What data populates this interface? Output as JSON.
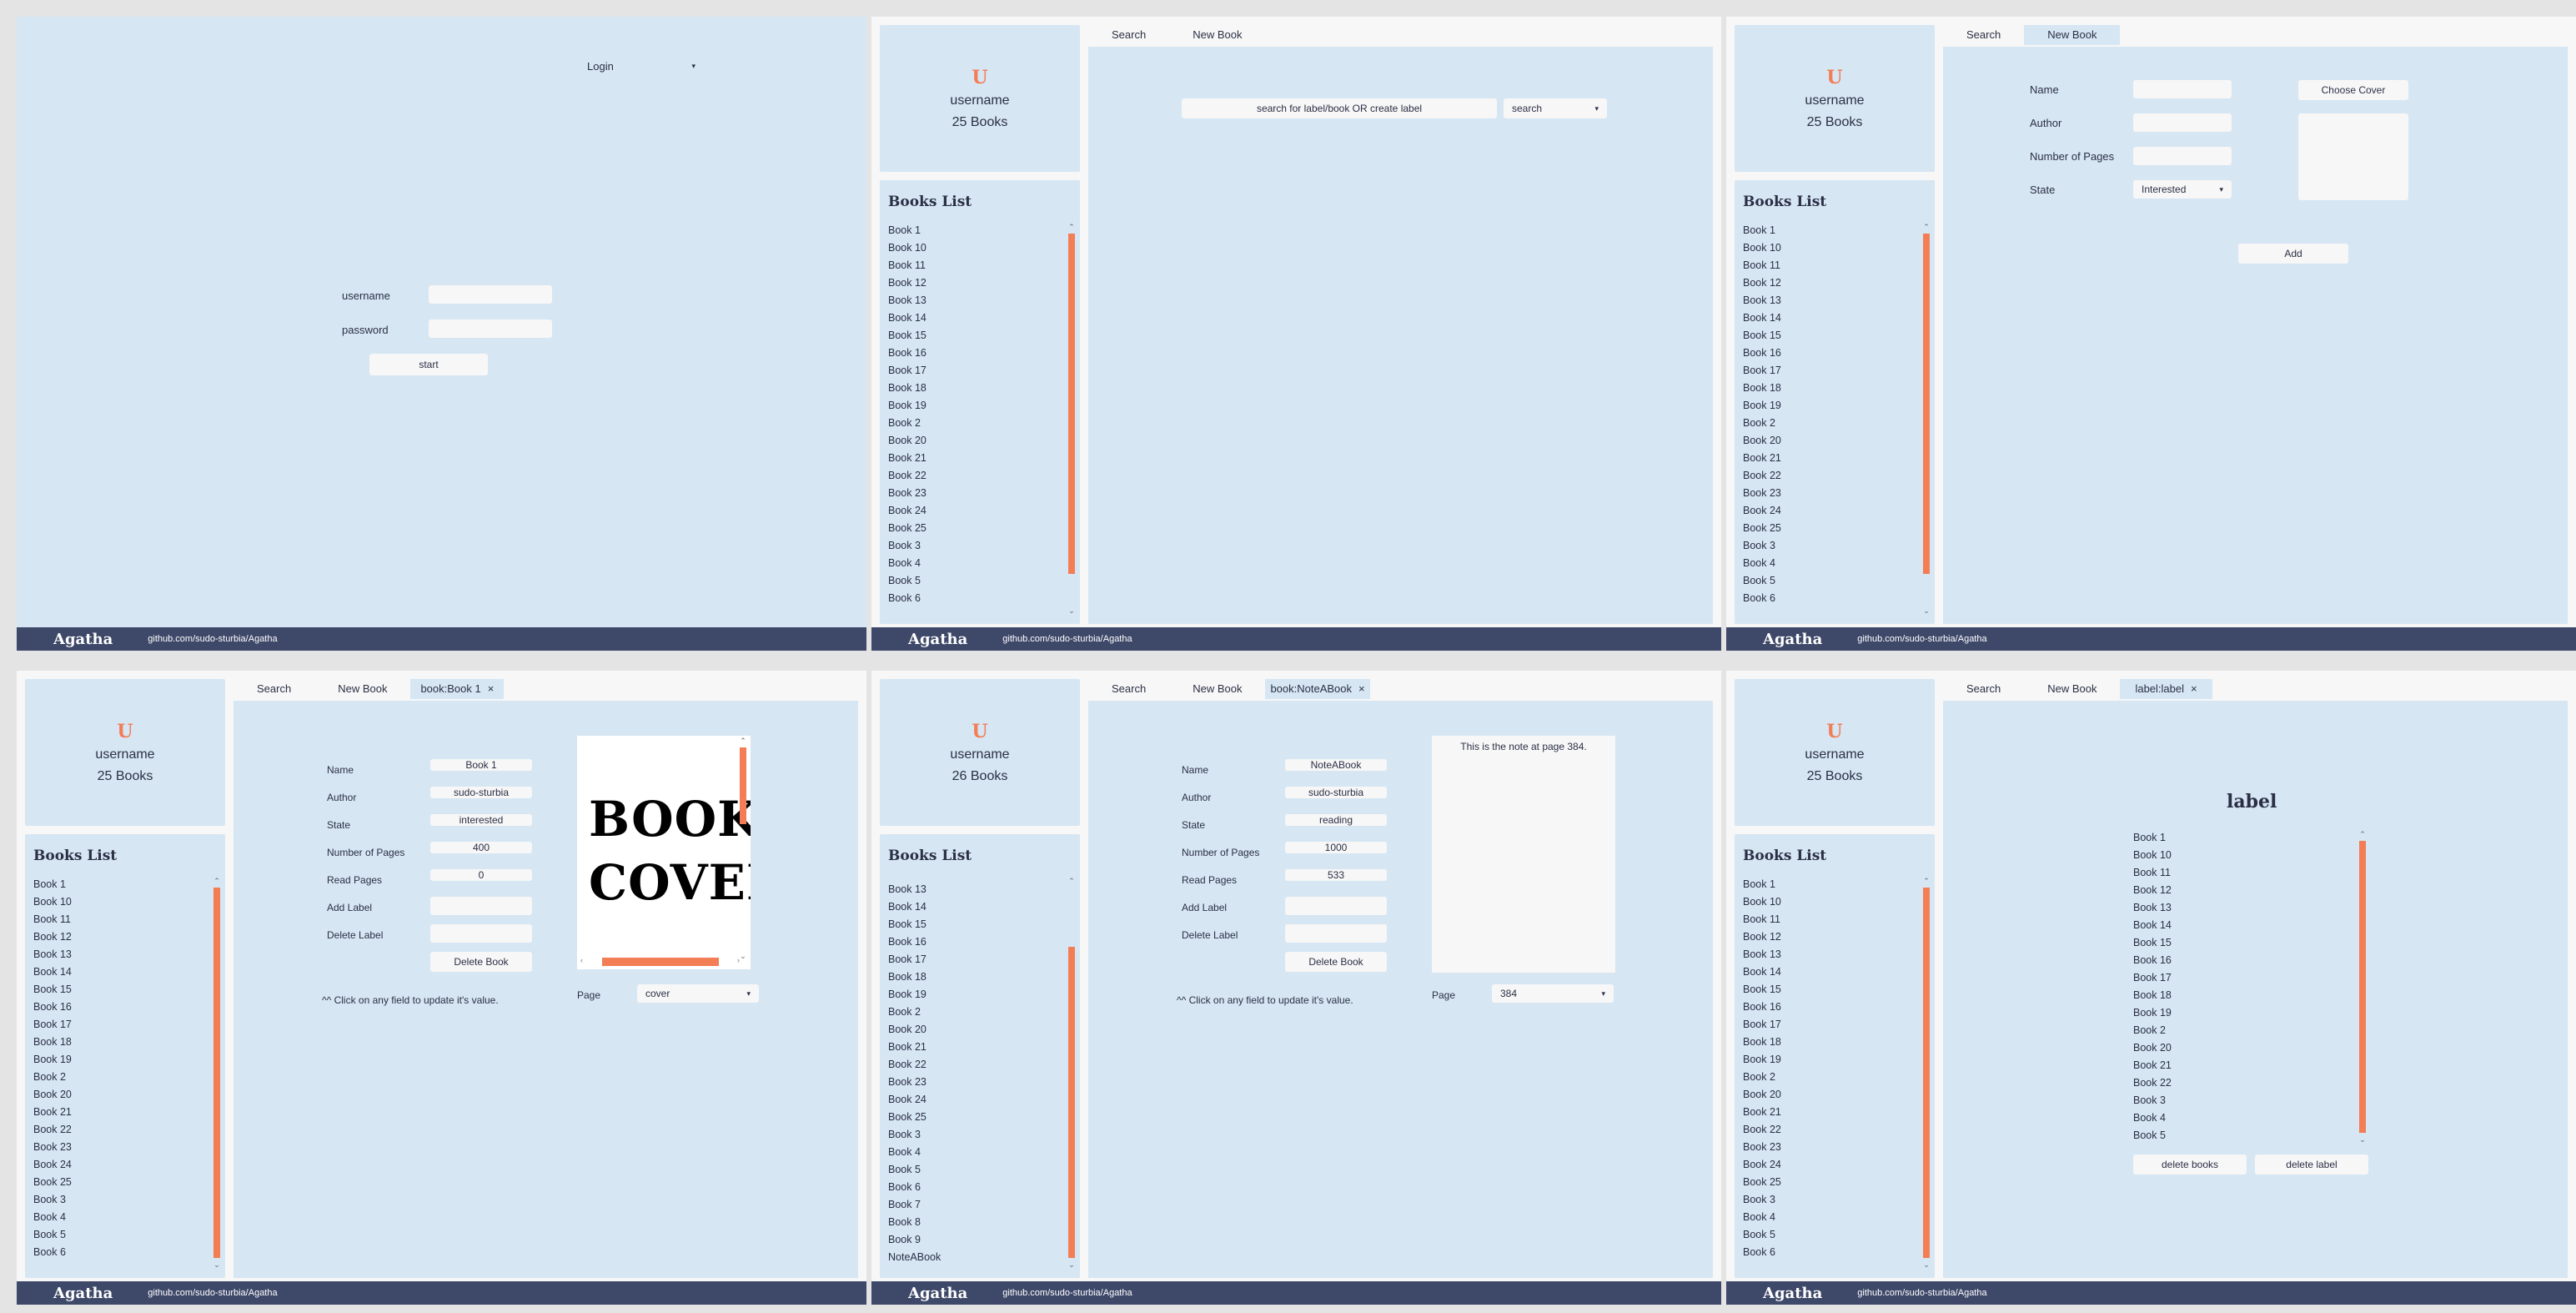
{
  "app": {
    "brand": "Agatha",
    "repo_url": "github.com/sudo-sturbia/Agatha"
  },
  "login": {
    "login_dropdown": "Login",
    "username_label": "username",
    "password_label": "password",
    "start_button": "start"
  },
  "profile_25": {
    "initial": "U",
    "username": "username",
    "books_count": "25 Books"
  },
  "profile_26": {
    "initial": "U",
    "username": "username",
    "books_count": "26 Books"
  },
  "books_list_title": "Books List",
  "books_list_full": [
    "Book 1",
    "Book 10",
    "Book 11",
    "Book 12",
    "Book 13",
    "Book 14",
    "Book 15",
    "Book 16",
    "Book 17",
    "Book 18",
    "Book 19",
    "Book 2",
    "Book 20",
    "Book 21",
    "Book 22",
    "Book 23",
    "Book 24",
    "Book 25",
    "Book 3",
    "Book 4",
    "Book 5",
    "Book 6"
  ],
  "books_list_scrolled": [
    "Book 13",
    "Book 14",
    "Book 15",
    "Book 16",
    "Book 17",
    "Book 18",
    "Book 19",
    "Book 2",
    "Book 20",
    "Book 21",
    "Book 22",
    "Book 23",
    "Book 24",
    "Book 25",
    "Book 3",
    "Book 4",
    "Book 5",
    "Book 6",
    "Book 7",
    "Book 8",
    "Book 9",
    "NoteABook"
  ],
  "tabs": {
    "search": "Search",
    "new_book": "New Book",
    "book1": "book:Book 1",
    "note_a_book": "book:NoteABook",
    "label": "label:label",
    "close": "×"
  },
  "search_view": {
    "search_field": "search for label/book OR create label",
    "search_mode": "search",
    "mode_arrow": "▾"
  },
  "new_book_form": {
    "name_label": "Name",
    "author_label": "Author",
    "pages_label": "Number of Pages",
    "state_label": "State",
    "state_value": "Interested",
    "choose_cover_button": "Choose Cover",
    "add_button": "Add"
  },
  "book_view_labels": {
    "name": "Name",
    "author": "Author",
    "state": "State",
    "pages": "Number of Pages",
    "read_pages": "Read Pages",
    "add_label": "Add Label",
    "delete_label": "Delete Label",
    "delete_book_button": "Delete Book",
    "hint": "^^ Click on any field to update it's value.",
    "page_label": "Page"
  },
  "book1": {
    "name": "Book 1",
    "author": "sudo-sturbia",
    "state": "interested",
    "pages": "400",
    "read_pages": "0",
    "cover_text_line1": "BOOK",
    "cover_text_line2": "COVER",
    "page_select": "cover"
  },
  "note_a_book": {
    "name": "NoteABook",
    "author": "sudo-sturbia",
    "state": "reading",
    "pages": "1000",
    "read_pages": "533",
    "note_text": "This is the note at page 384.",
    "page_select": "384"
  },
  "label_view": {
    "title": "label",
    "books": [
      "Book 1",
      "Book 10",
      "Book 11",
      "Book 12",
      "Book 13",
      "Book 14",
      "Book 15",
      "Book 16",
      "Book 17",
      "Book 18",
      "Book 19",
      "Book 2",
      "Book 20",
      "Book 21",
      "Book 22",
      "Book 3",
      "Book 4",
      "Book 5"
    ],
    "delete_books_button": "delete books",
    "delete_label_button": "delete label"
  },
  "colors": {
    "panel_bg": "#d6e6f3",
    "accent": "#f37e56",
    "footer_bg": "#3e4869",
    "field_bg": "#f7f7f7"
  }
}
